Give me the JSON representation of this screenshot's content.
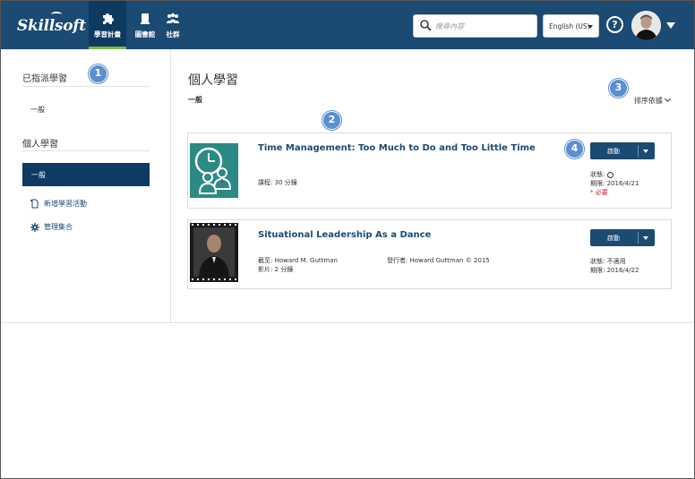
{
  "header": {
    "logo": "Skillsoft",
    "nav": [
      {
        "label": "學習計畫",
        "icon": "puzzle-icon",
        "active": true
      },
      {
        "label": "圖書館",
        "icon": "library-icon",
        "active": false
      },
      {
        "label": "社群",
        "icon": "community-icon",
        "active": false
      }
    ],
    "search_placeholder": "搜尋內容",
    "language": "English (US)",
    "help": "?",
    "accent": "#1b4a73"
  },
  "sidebar": {
    "assigned_heading": "已指派學習",
    "assigned_item": "一般",
    "personal_heading": "個人學習",
    "personal_item": "一般",
    "add_activity": "新增學習活動",
    "manage_collections": "管理集合"
  },
  "main": {
    "title": "個人學習",
    "subtitle": "一般",
    "sort_label": "排序依據",
    "cards": [
      {
        "title": "Time Management: Too Much to Do and Too Little Time",
        "meta_line1": "課程: 30 分鐘",
        "launch_label": "啟動",
        "status_label": "狀態:",
        "due_label": "期限: 2016/4/21",
        "required": "* 必要"
      },
      {
        "title": "Situational Leadership As a Dance",
        "author": "截至: Howard M. Guttman",
        "publisher": "發行者: Howard Guttman © 2015",
        "duration": "影片: 2 分鐘",
        "launch_label": "啟動",
        "status_label": "狀態: 不適用",
        "due_label": "期限: 2016/4/22"
      }
    ]
  },
  "callouts": [
    "1",
    "2",
    "3",
    "4"
  ]
}
